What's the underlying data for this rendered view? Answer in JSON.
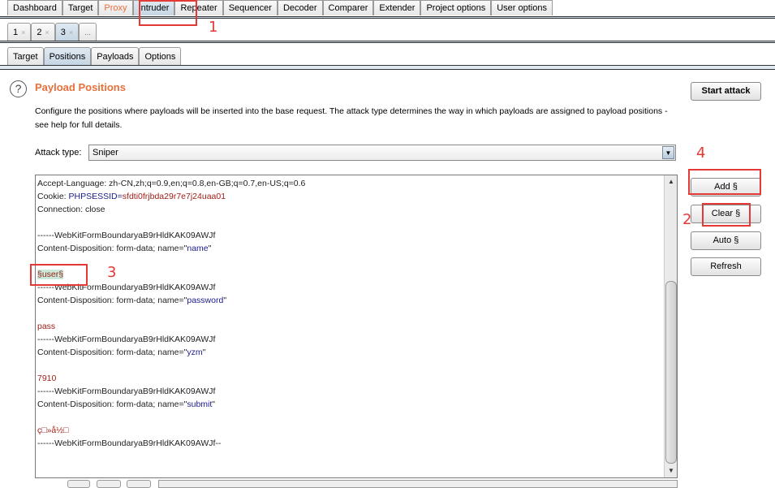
{
  "main_tabs": [
    {
      "label": "Dashboard"
    },
    {
      "label": "Target"
    },
    {
      "label": "Proxy"
    },
    {
      "label": "Intruder"
    },
    {
      "label": "Repeater"
    },
    {
      "label": "Sequencer"
    },
    {
      "label": "Decoder"
    },
    {
      "label": "Comparer"
    },
    {
      "label": "Extender"
    },
    {
      "label": "Project options"
    },
    {
      "label": "User options"
    }
  ],
  "attack_tabs": [
    {
      "label": "1",
      "close": "×"
    },
    {
      "label": "2",
      "close": "×"
    },
    {
      "label": "3",
      "close": "×"
    },
    {
      "label": "...",
      "close": ""
    }
  ],
  "sub_tabs": [
    {
      "label": "Target"
    },
    {
      "label": "Positions"
    },
    {
      "label": "Payloads"
    },
    {
      "label": "Options"
    }
  ],
  "panel": {
    "help": "?",
    "title": "Payload Positions",
    "description": "Configure the positions where payloads will be inserted into the base request. The attack type determines the way in which payloads are assigned to payload positions - see help for full details.",
    "attack_type_label": "Attack type:",
    "attack_type_value": "Sniper"
  },
  "buttons": {
    "start_attack": "Start attack",
    "add": "Add §",
    "clear": "Clear §",
    "auto": "Auto §",
    "refresh": "Refresh"
  },
  "request": {
    "l1": "Accept-Language: zh-CN,zh;q=0.9,en;q=0.8,en-GB;q=0.7,en-US;q=0.6",
    "l2a": "Cookie: ",
    "l2b": "PHPSESSID",
    "l2c": "=",
    "l2d": "sfdti0frjbda29r7e7j24uaa01",
    "l3": "Connection: close",
    "boundary": "------WebKitFormBoundaryaB9rHldKAK09AWJf",
    "cd": "Content-Disposition: form-data; name=\"",
    "q": "\"",
    "n1": "name",
    "marked": "§user§",
    "n2": "password",
    "v2": "pass",
    "n3": "yzm",
    "v3": "7910",
    "n4": "submit",
    "v4": "ç□»å½□",
    "end": "------WebKitFormBoundaryaB9rHldKAK09AWJf--"
  },
  "annotations": {
    "a1": "1",
    "a2": "2",
    "a3": "3",
    "a4": "4"
  },
  "colors": {
    "accent": "#e8703a",
    "annotation": "#e53935",
    "key": "#1a1a8c",
    "value": "#a0201a"
  }
}
